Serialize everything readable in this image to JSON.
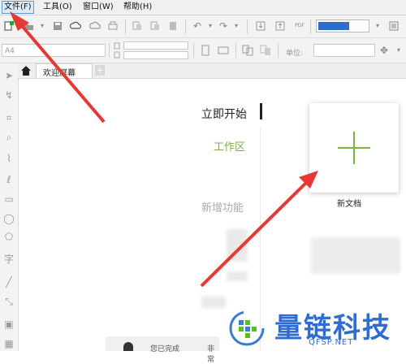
{
  "menu": {
    "items": [
      {
        "label": "文件(F)",
        "active": true
      },
      {
        "label": "工具(O)",
        "active": false
      },
      {
        "label": "窗口(W)",
        "active": false
      },
      {
        "label": "帮助(H)",
        "active": false
      }
    ]
  },
  "toolbar": {
    "page_size_placeholder": "A4",
    "unit_label": "单位:"
  },
  "tabs": {
    "home_icon": "home-icon",
    "welcome_label": "欢迎屏幕",
    "add_label": "+"
  },
  "welcome": {
    "start_heading": "立即开始",
    "workspace_link": "工作区",
    "new_features": "新增功能",
    "new_document_label": "新文档",
    "accent_color": "#7cb342"
  },
  "watermark": {
    "text": "量链科技",
    "url": "QFSP.NET"
  },
  "footer": {
    "partial_text_1": "您已完成",
    "partial_text_2": "非常"
  },
  "colors": {
    "arrow": "#e53935",
    "accent": "#7cb342",
    "menu_highlight": "#5b9bd5",
    "watermark_blue": "#3a7bd5",
    "watermark_green": "#52c41a"
  }
}
